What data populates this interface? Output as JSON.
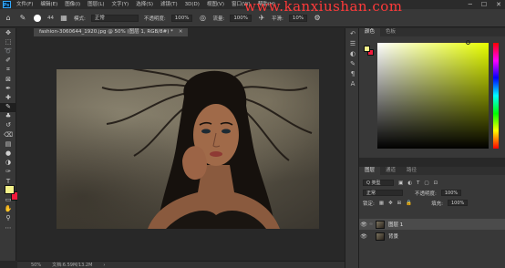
{
  "menu": {
    "items": [
      "文件(F)",
      "编辑(E)",
      "图像(I)",
      "图层(L)",
      "文字(Y)",
      "选择(S)",
      "滤镜(T)",
      "3D(D)",
      "视图(V)",
      "窗口(W)",
      "帮助(H)"
    ],
    "logo": "Ps",
    "window_controls": [
      "─",
      "☐",
      "✕"
    ]
  },
  "watermark": "www.kanxiushan.com",
  "options": {
    "brush_size": "44",
    "mode_label": "模式:",
    "mode_value": "正常",
    "opacity_label": "不透明度:",
    "opacity_value": "100%",
    "flow_label": "流量:",
    "flow_value": "100%",
    "smoothing_label": "平滑:",
    "smoothing_value": "10%"
  },
  "document": {
    "tab_title": "fashion-3060644_1920.jpg @ 50% (图层 1, RGB/8#) *",
    "zoom": "50%",
    "doc_info": "文档:6.59M/13.2M"
  },
  "color_panel": {
    "tabs": [
      "颜色",
      "色板"
    ],
    "fg_color": "#f4f28a",
    "bg_color": "#f01a3c",
    "hue": "#e8ff00"
  },
  "layers_panel": {
    "tabs": [
      "图层",
      "通道",
      "路径"
    ],
    "filter_label": "Q 类型",
    "blend_mode": "正常",
    "opacity_label": "不透明度:",
    "opacity_value": "100%",
    "lock_label": "锁定:",
    "fill_label": "填充:",
    "fill_value": "100%",
    "layers": [
      {
        "name": "图层 1",
        "selected": true
      },
      {
        "name": "背景",
        "selected": false
      }
    ]
  }
}
